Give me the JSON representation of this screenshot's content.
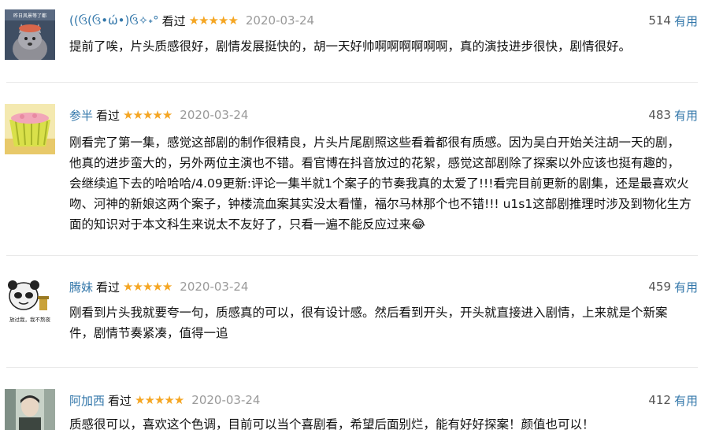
{
  "comments": [
    {
      "username": "((ઉ(ઉ•ώ•)ઉ✧˖°",
      "status": "看过",
      "rating": 5,
      "date": "2020-03-24",
      "votes": "514",
      "vote_label": "有用",
      "avatar_caption": "昨日风景等了都",
      "content": "提前了唉，片头质感很好，剧情发展挺快的，胡一天好帅啊啊啊啊啊啊，真的演技进步很快，剧情很好。"
    },
    {
      "username": "参半",
      "status": "看过",
      "rating": 5,
      "date": "2020-03-24",
      "votes": "483",
      "vote_label": "有用",
      "content": "刚看完了第一集，感觉这部剧的制作很精良，片头片尾剧照这些看着都很有质感。因为吴白开始关注胡一天的剧，他真的进步蛮大的，另外两位主演也不错。看官博在抖音放过的花絮，感觉这部剧除了探案以外应该也挺有趣的，会继续追下去的哈哈哈/4.09更新:评论一集半就1个案子的节奏我真的太爱了!!!看完目前更新的剧集，还是最喜欢火吻、河神的新娘这两个案子，钟楼流血案其实没太看懂，福尔马林那个也不错!!! u1s1这部剧推理时涉及到物化生方面的知识对于本文科生来说太不友好了，只看一遍不能反应过来😂"
    },
    {
      "username": "腾妹",
      "status": "看过",
      "rating": 5,
      "date": "2020-03-24",
      "votes": "459",
      "vote_label": "有用",
      "avatar_caption": "放过我，我不熬夜",
      "content": "刚看到片头我就要夸一句，质感真的可以，很有设计感。然后看到开头，开头就直接进入剧情，上来就是个新案件，剧情节奏紧凑，值得一追"
    },
    {
      "username": "阿加西",
      "status": "看过",
      "rating": 5,
      "date": "2020-03-24",
      "votes": "412",
      "vote_label": "有用",
      "content": "质感很可以，喜欢这个色调，目前可以当个喜剧看，希望后面别烂，能有好好探案！颜值也可以！"
    }
  ],
  "colors": {
    "username": "#3377aa",
    "star": "#f5a623",
    "date": "#9a9a9a",
    "divider": "#e9e9e9"
  }
}
